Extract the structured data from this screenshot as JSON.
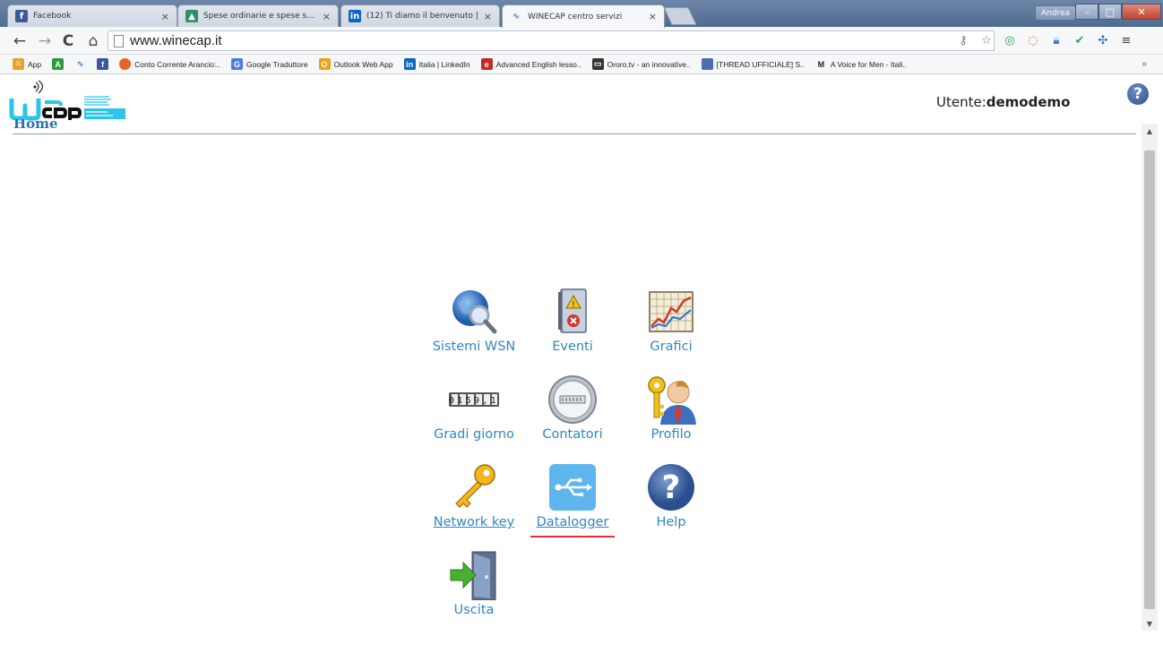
{
  "browser": {
    "tabs": [
      {
        "title": "Facebook",
        "icon": "facebook-icon",
        "color": "#3b5998"
      },
      {
        "title": "Spese ordinarie e spese stra",
        "icon": "map-icon",
        "color": "#2f8f6a"
      },
      {
        "title": "(12) Ti diamo il benvenuto |",
        "icon": "linkedin-icon",
        "color": "#0a66c2"
      },
      {
        "title": "WINECAP centro servizi",
        "icon": "pulse-icon",
        "color": "#3a7bd5"
      }
    ],
    "user_badge": "Andrea",
    "url": "www.winecap.it",
    "bookmarks": [
      {
        "label": "App",
        "color": "#e8a22c"
      },
      {
        "label": "",
        "color": "#2e9a3c",
        "glyph": "A"
      },
      {
        "label": "",
        "color": "#3a7bd5",
        "glyph": "~"
      },
      {
        "label": "",
        "color": "#3b5998",
        "glyph": "f"
      },
      {
        "label": "Conto Corrente Arancio:..",
        "color": "#e5622a"
      },
      {
        "label": "Google Traduttore",
        "color": "#4a7fe0"
      },
      {
        "label": "Outlook Web App",
        "color": "#f0a30a"
      },
      {
        "label": "Italia | LinkedIn",
        "color": "#0a66c2"
      },
      {
        "label": "Advanced English lesso..",
        "color": "#c62828"
      },
      {
        "label": "Ororo.tv - an innovative..",
        "color": "#333333"
      },
      {
        "label": "[THREAD UFFICIALE] S..",
        "color": "#4a6fb0"
      },
      {
        "label": "A Voice for Men - Itali..",
        "color": "#222222"
      }
    ],
    "bookmarks_more": "»"
  },
  "header": {
    "utente_label": "Utente:",
    "utente_name": "demodemo",
    "help_glyph": "?",
    "breadcrumb": "Home"
  },
  "menu": [
    {
      "label": "Sistemi WSN",
      "icon": "globe-search-icon"
    },
    {
      "label": "Eventi",
      "icon": "notebook-warning-icon"
    },
    {
      "label": "Grafici",
      "icon": "chart-icon"
    },
    {
      "label": "Gradi giorno",
      "icon": "odometer-icon",
      "digits": "0159,1"
    },
    {
      "label": "Contatori",
      "icon": "meter-icon"
    },
    {
      "label": "Profilo",
      "icon": "user-key-icon"
    },
    {
      "label": "Network key",
      "icon": "key-icon"
    },
    {
      "label": "Datalogger",
      "icon": "usb-icon"
    },
    {
      "label": "Help",
      "icon": "help-icon",
      "glyph": "?"
    },
    {
      "label": "Uscita",
      "icon": "exit-door-icon"
    }
  ]
}
